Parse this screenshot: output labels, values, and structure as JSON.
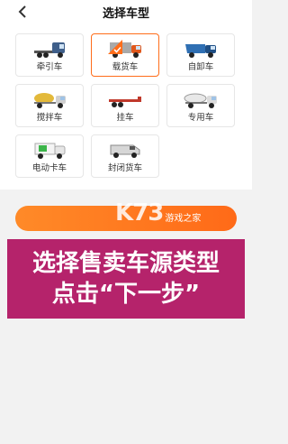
{
  "header": {
    "back_icon": "chevron-left-icon",
    "title": "选择车型"
  },
  "vehicle_types": [
    {
      "label": "牵引车",
      "icon": "tractor-truck-icon",
      "selected": false
    },
    {
      "label": "载货车",
      "icon": "cargo-truck-icon",
      "selected": true
    },
    {
      "label": "自卸车",
      "icon": "dump-truck-icon",
      "selected": false
    },
    {
      "label": "搅拌车",
      "icon": "mixer-truck-icon",
      "selected": false
    },
    {
      "label": "挂车",
      "icon": "trailer-icon",
      "selected": false
    },
    {
      "label": "专用车",
      "icon": "special-truck-icon",
      "selected": false
    },
    {
      "label": "电动卡车",
      "icon": "electric-truck-icon",
      "selected": false
    },
    {
      "label": "封闭货车",
      "icon": "closed-van-icon",
      "selected": false
    }
  ],
  "watermark": {
    "logo": "K73",
    "text": "游戏之家"
  },
  "overlay_caption": {
    "line1": "选择售卖车源类型",
    "line2": "点击“下一步”"
  },
  "colors": {
    "accent": "#ff6d1a",
    "overlay": "#b5236b"
  }
}
